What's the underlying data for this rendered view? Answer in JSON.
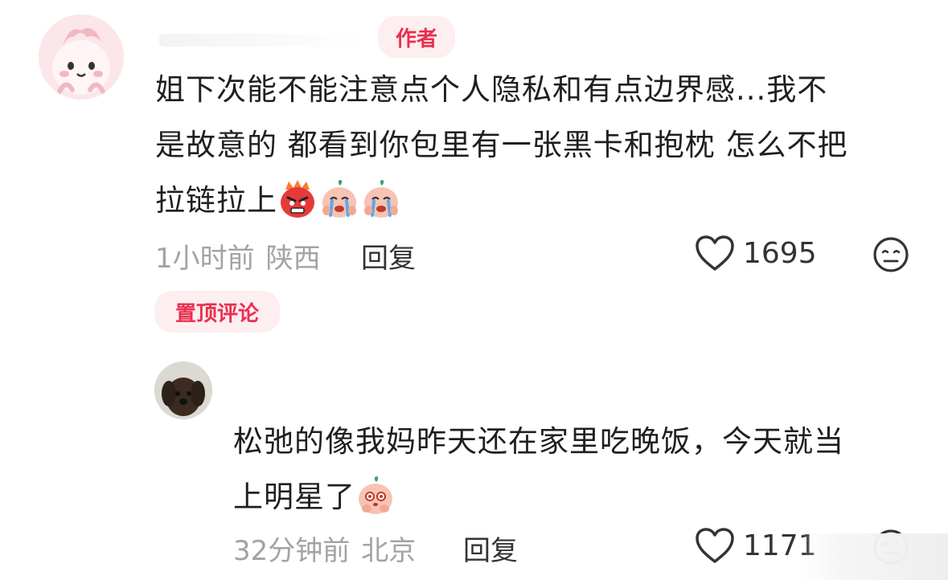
{
  "comment": {
    "author_badge": "作者",
    "text_line1": "姐下次能不能注意点个人隐私和有点边界感...我不",
    "text_line2": "是故意的 都看到你包里有一张黑卡和抱枕 怎么不把",
    "text_line3": "拉链拉上",
    "emojis": [
      "angry-emoji",
      "crying-emoji",
      "crying-emoji"
    ],
    "time": "1小时前",
    "location": "陕西",
    "reply_label": "回复",
    "likes": "1695"
  },
  "pinned_badge": "置顶评论",
  "reply": {
    "text_line1": "松弛的像我妈昨天还在家里吃晚饭，今天就当",
    "text_line2": "上明星了",
    "emojis": [
      "touched-emoji"
    ],
    "time": "32分钟前",
    "location": "北京",
    "reply_label": "回复",
    "likes": "1171"
  },
  "icons": {
    "like": "heart-icon",
    "dislike": "dislike-face-icon"
  },
  "colors": {
    "accent": "#e8304f",
    "badge_bg": "#fdeef0",
    "meta": "#a3a3a3"
  }
}
